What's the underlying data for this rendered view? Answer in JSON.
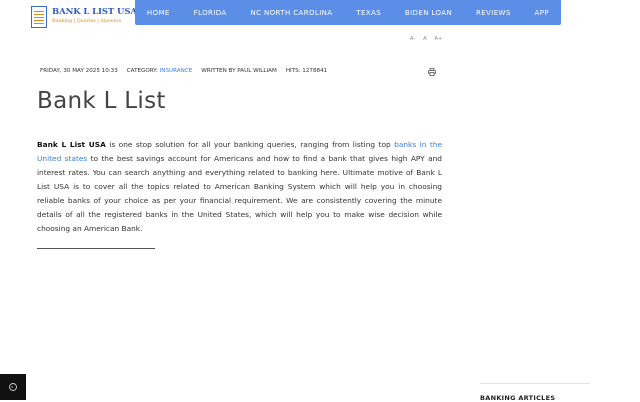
{
  "logo": {
    "title": "BANK L LIST USA",
    "subtitle": "Banking | Queries | Answers"
  },
  "nav": {
    "items": [
      {
        "label": "HOME"
      },
      {
        "label": "FLORIDA"
      },
      {
        "label": "NC NORTH CAROLINA"
      },
      {
        "label": "TEXAS"
      },
      {
        "label": "BIDEN LOAN"
      },
      {
        "label": "REVIEWS"
      },
      {
        "label": "APP"
      }
    ]
  },
  "text_tools": {
    "decrease": "A-",
    "reset": "A",
    "increase": "A+"
  },
  "meta": {
    "date": "FRIDAY, 30 MAY 2025 10:33",
    "category_label": "CATEGORY:",
    "category_value": "INSURANCE",
    "author": "WRITTEN BY PAUL WILLIAM",
    "hits": "HITS: 1278841"
  },
  "article": {
    "title": "Bank L List",
    "brand": "Bank L List USA",
    "p1": " is one stop solution for all your banking queries, ranging from listing top ",
    "link": "banks in the United states",
    "p2": " to the best savings account for Americans and how to find a bank that gives high APY and interest rates. You can search anything and everything related to banking here. Ultimate motive of Bank L List USA is to cover all the topics related to American Banking System which will help you in choosing reliable banks of your choice as per your financial requirement. We are consistently covering the minute details of all the registered banks in the United States, which will help you to make wise decision while choosing an American Bank."
  },
  "sidebar": {
    "heading": "BANKING ARTICLES"
  },
  "colors": {
    "nav_bg": "#5b8ee6",
    "link": "#3a7fd8",
    "logo_blue": "#2d5fb8",
    "logo_orange": "#e08a1e"
  }
}
